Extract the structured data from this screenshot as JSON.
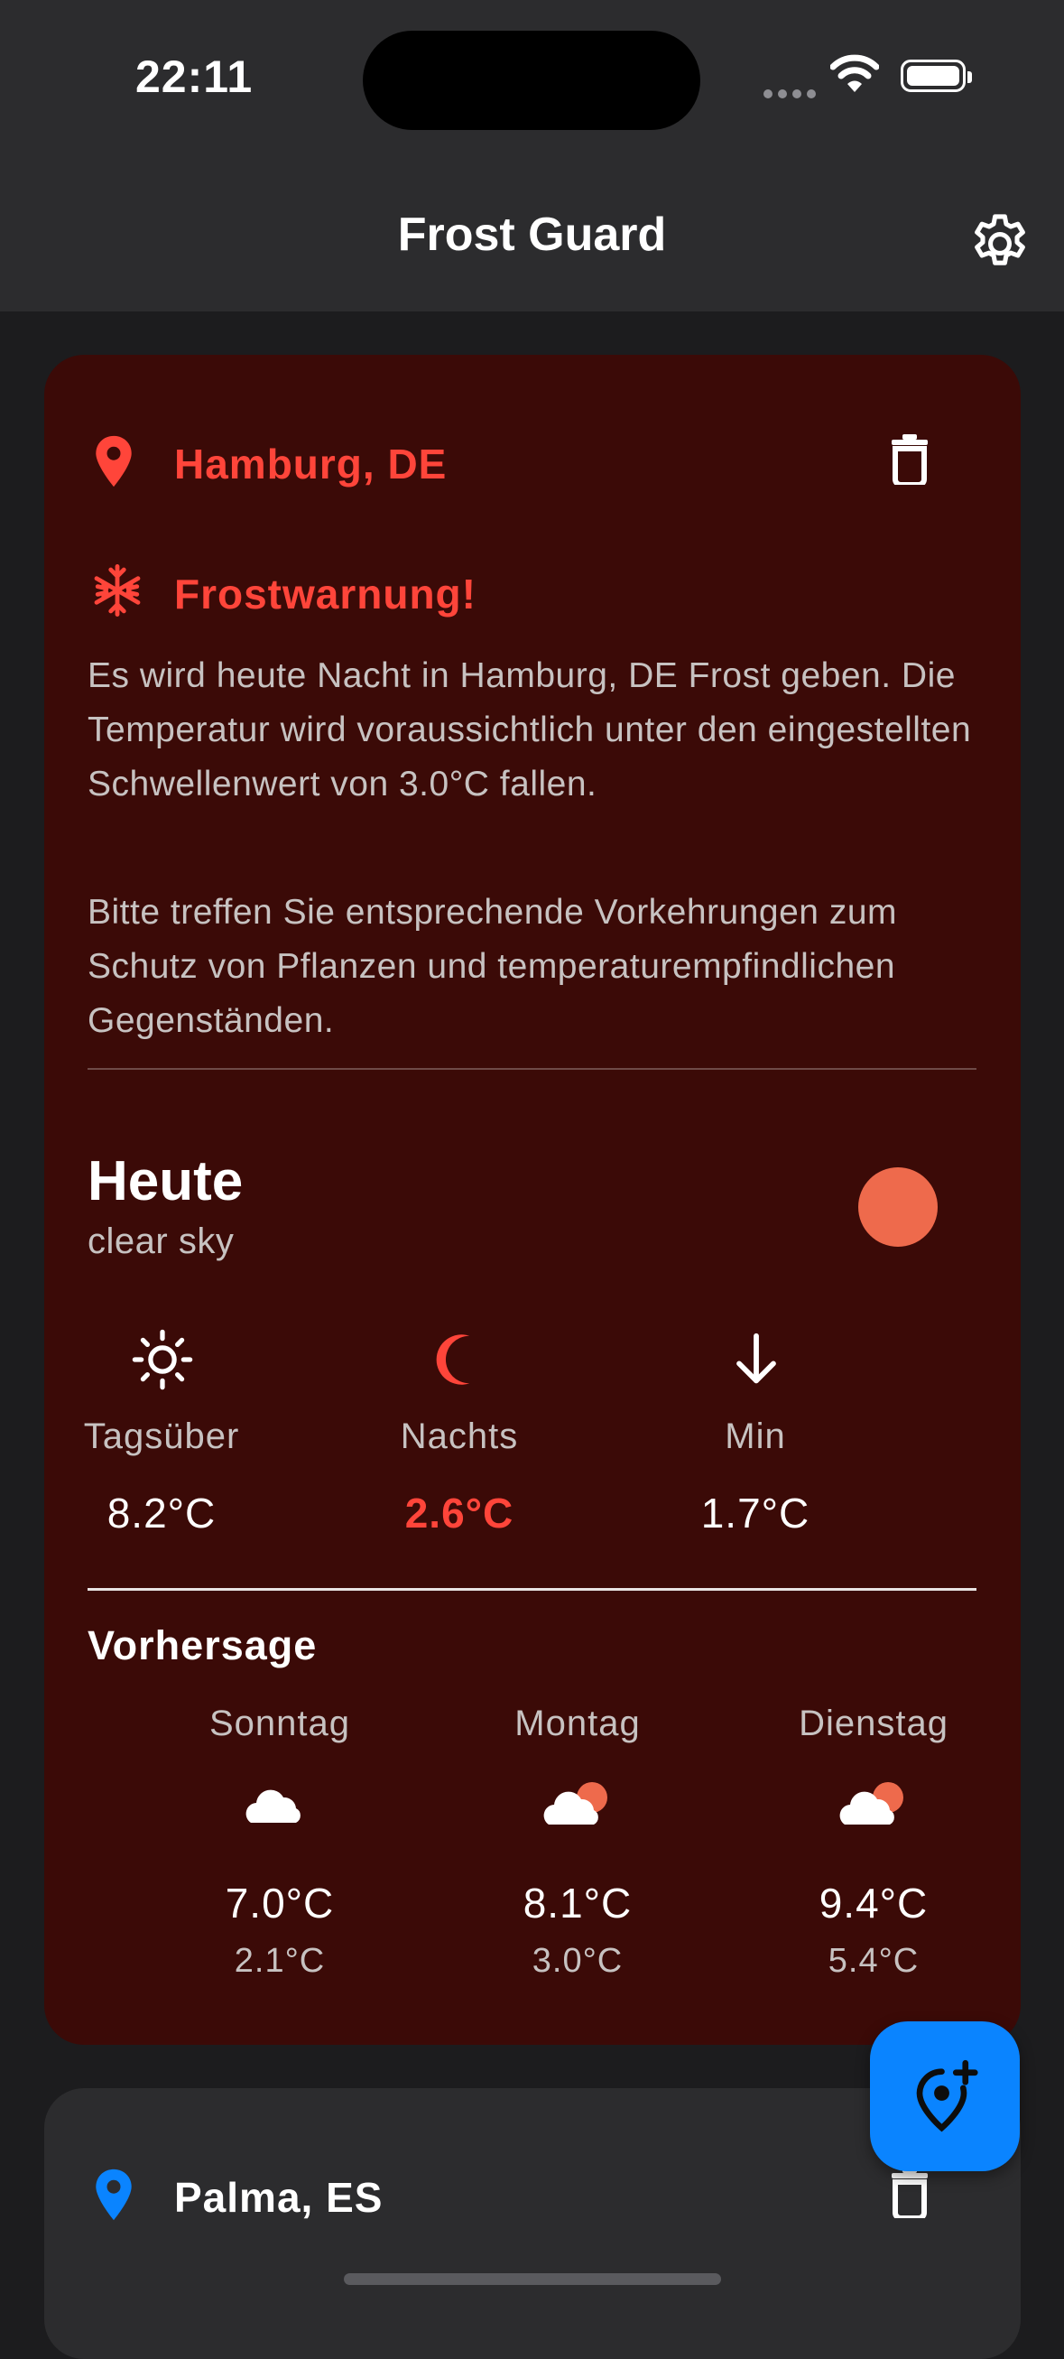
{
  "status_bar": {
    "time": "22:11"
  },
  "app_bar": {
    "title": "Frost Guard",
    "settings_icon": "gear-icon"
  },
  "colors": {
    "alert": "#ff453a",
    "accent": "#0a84ff",
    "card_alert_bg": "#3b0a07",
    "card_bg": "#2c2c2e"
  },
  "locations": [
    {
      "name": "Hamburg, DE",
      "frost_warning": {
        "title": "Frostwarnung!",
        "text": "Es wird heute Nacht in Hamburg, DE Frost geben. Die Temperatur wird voraussichtlich unter den eingestellten Schwellenwert von 3.0°C fallen.",
        "advice": "Bitte treffen Sie entsprechende Vorkehrungen zum Schutz von Pflanzen und temperaturempfindlichen Gegenständen."
      },
      "today": {
        "title": "Heute",
        "description": "clear sky",
        "stats": [
          {
            "icon": "sun-icon",
            "label": "Tagsüber",
            "value": "8.2°C"
          },
          {
            "icon": "moon-icon",
            "label": "Nachts",
            "value": "2.6°C"
          },
          {
            "icon": "arrow-down-icon",
            "label": "Min",
            "value": "1.7°C"
          }
        ]
      },
      "forecast": {
        "title": "Vorhersage",
        "days": [
          {
            "day": "Sonntag",
            "icon": "cloud-icon",
            "high": "7.0°C",
            "low": "2.1°C"
          },
          {
            "day": "Montag",
            "icon": "partly-cloudy-icon",
            "high": "8.1°C",
            "low": "3.0°C"
          },
          {
            "day": "Dienstag",
            "icon": "partly-cloudy-icon",
            "high": "9.4°C",
            "low": "5.4°C"
          }
        ]
      }
    },
    {
      "name": "Palma, ES"
    }
  ],
  "fab": {
    "icon": "add-location-icon"
  }
}
